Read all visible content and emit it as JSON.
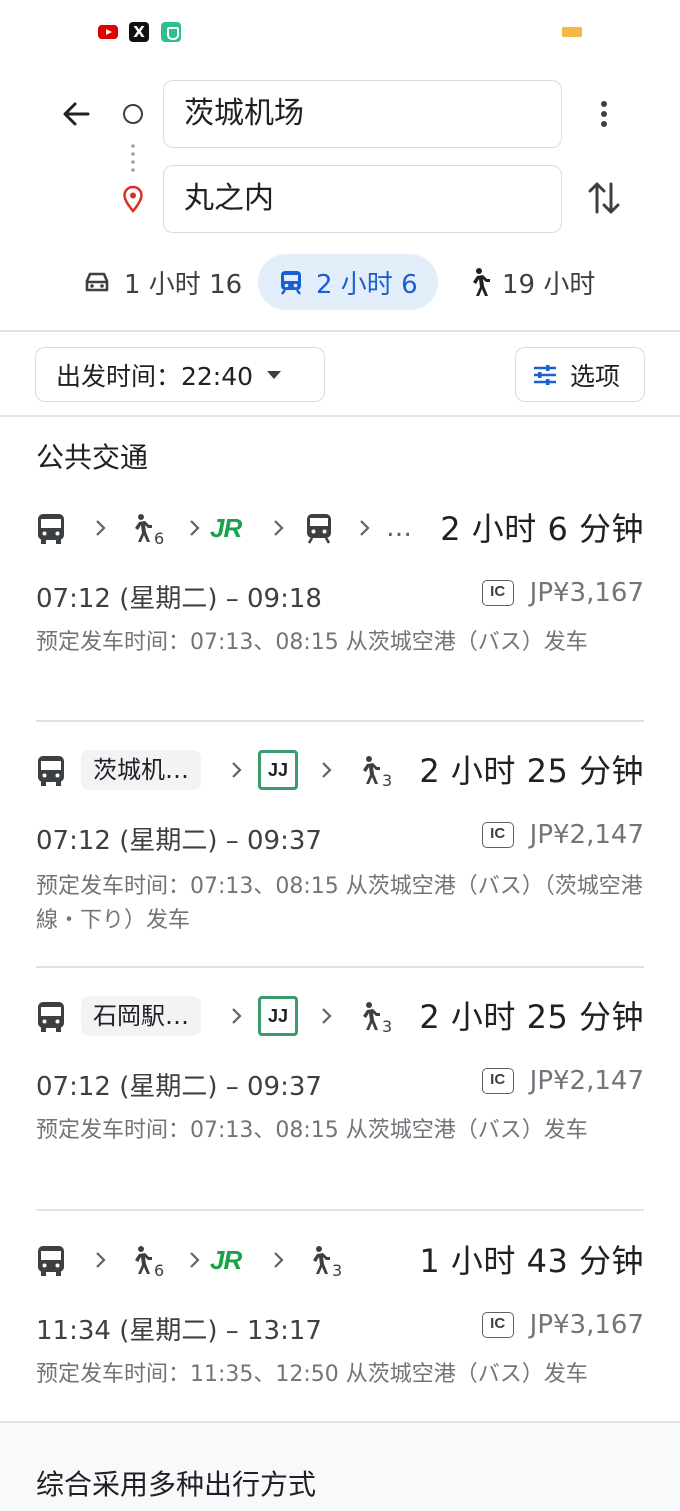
{
  "status_bar": {
    "x_icon_label": "X"
  },
  "search": {
    "origin": "茨城机场",
    "destination": "丸之内"
  },
  "modes": [
    {
      "label": "1 小时 16",
      "icon": "car-icon",
      "selected": false
    },
    {
      "label": "2 小时 6",
      "icon": "train-icon",
      "selected": true
    },
    {
      "label": "19 小时",
      "icon": "walk-icon",
      "selected": false
    }
  ],
  "controls": {
    "depart_label": "出发时间：22:40",
    "options_label": "选项"
  },
  "section_title": "公共交通",
  "routes": [
    {
      "duration": "2 小时 6 分钟",
      "walk_mins": [
        "6"
      ],
      "ellipsis": "…",
      "jr_label": "JR",
      "times": "07:12 (星期二) – 09:18",
      "ic_label": "IC",
      "fare": "JP¥3,167",
      "schedule": "预定发车时间：07:13、08:15 从茨城空港（バス）发车"
    },
    {
      "duration": "2 小时 25 分钟",
      "chip": "茨城机…",
      "jj_label": "JJ",
      "walk_mins": [
        "3"
      ],
      "times": "07:12 (星期二) – 09:37",
      "ic_label": "IC",
      "fare": "JP¥2,147",
      "schedule": "预定发车时间：07:13、08:15 从茨城空港（バス）（茨城空港線・下り）发车"
    },
    {
      "duration": "2 小时 25 分钟",
      "chip": "石岡駅…",
      "jj_label": "JJ",
      "walk_mins": [
        "3"
      ],
      "times": "07:12 (星期二) – 09:37",
      "ic_label": "IC",
      "fare": "JP¥2,147",
      "schedule": "预定发车时间：07:13、08:15 从茨城空港（バス）发车"
    },
    {
      "duration": "1 小时 43 分钟",
      "walk_mins": [
        "6",
        "3"
      ],
      "jr_label": "JR",
      "times": "11:34 (星期二) – 13:17",
      "ic_label": "IC",
      "fare": "JP¥3,167",
      "schedule": "预定发车时间：11:35、12:50 从茨城空港（バス）发车"
    }
  ],
  "bottom_section_title": "综合采用多种出行方式",
  "colors": {
    "accent": "#1a60d0",
    "selected_bg": "#e3eefb",
    "jr_green": "#17a34a",
    "pin_red": "#d93025"
  }
}
